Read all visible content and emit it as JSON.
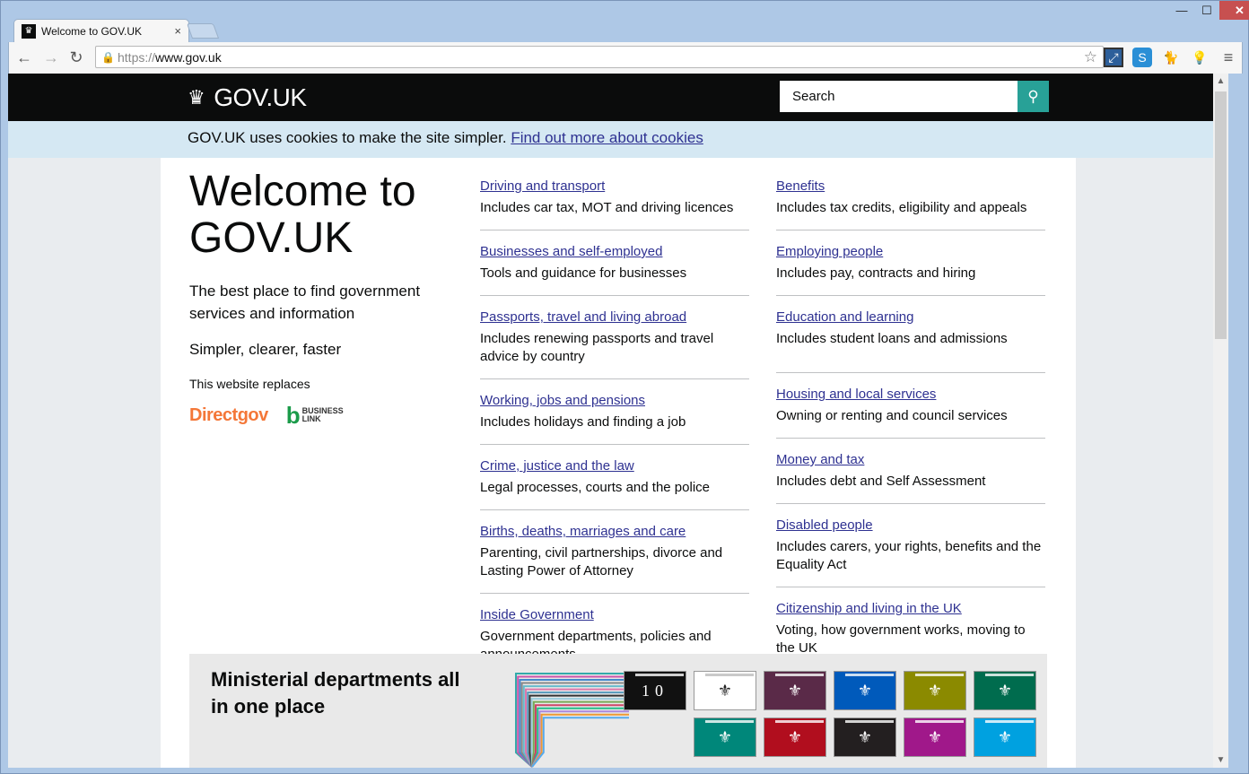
{
  "browser": {
    "tab_title": "Welcome to GOV.UK",
    "tab_close": "×",
    "url_scheme": "https://",
    "url_host": "www.gov.uk",
    "window_controls": {
      "minimize": "—",
      "maximize": "☐",
      "close": "✕"
    },
    "nav": {
      "back": "←",
      "forward": "→",
      "reload": "↻"
    },
    "star": "☆",
    "menu": "≡"
  },
  "header": {
    "logo_text": "GOV.UK",
    "search_placeholder": "Search",
    "search_button": "🔍"
  },
  "cookie": {
    "text": "GOV.UK uses cookies to make the site simpler. ",
    "link": "Find out more about cookies"
  },
  "intro": {
    "title": "Welcome to GOV.UK",
    "lead": "The best place to find government services and information",
    "tagline": "Simpler, clearer, faster",
    "replaces": "This website replaces",
    "brand1": "Directgov",
    "brand2_line1": "BUSINESS",
    "brand2_line2": "LINK"
  },
  "topics_left": [
    {
      "link": "Driving and transport",
      "desc": "Includes car tax, MOT and driving licences"
    },
    {
      "link": "Businesses and self-employed",
      "desc": "Tools and guidance for businesses"
    },
    {
      "link": "Passports, travel and living abroad",
      "desc": "Includes renewing passports and travel advice by country"
    },
    {
      "link": "Working, jobs and pensions",
      "desc": "Includes holidays and finding a job"
    },
    {
      "link": "Crime, justice and the law",
      "desc": "Legal processes, courts and the police"
    },
    {
      "link": "Births, deaths, marriages and care",
      "desc": "Parenting, civil partnerships, divorce and Lasting Power of Attorney"
    },
    {
      "link": "Inside Government",
      "desc": "Government departments, policies and announcements"
    }
  ],
  "topics_right": [
    {
      "link": "Benefits",
      "desc": "Includes tax credits, eligibility and appeals"
    },
    {
      "link": "Employing people",
      "desc": "Includes pay, contracts and hiring"
    },
    {
      "link": "Education and learning",
      "desc": "Includes student loans and admissions"
    },
    {
      "link": "Housing and local services",
      "desc": "Owning or renting and council services"
    },
    {
      "link": "Money and tax",
      "desc": "Includes debt and Self Assessment"
    },
    {
      "link": "Disabled people",
      "desc": "Includes carers, your rights, benefits and the Equality Act"
    },
    {
      "link": "Citizenship and living in the UK",
      "desc": "Voting, how government works, moving to the UK"
    }
  ],
  "promo": {
    "title": "Ministerial departments all in one place",
    "number10": "10",
    "tile_colors": [
      "#ffffff",
      "#5a2a48",
      "#005abb",
      "#8b8a00",
      "#006c4e",
      "#00877a",
      "#b10e1e",
      "#231f20",
      "#a0188a",
      "#00a1e0"
    ]
  }
}
